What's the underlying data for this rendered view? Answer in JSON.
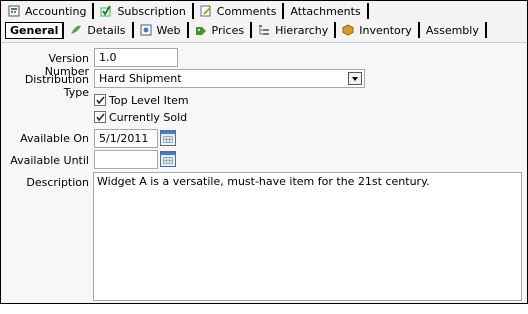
{
  "tabs_row1": [
    {
      "label": "Accounting",
      "icon": "accounting-icon"
    },
    {
      "label": "Subscription",
      "icon": "subscription-icon"
    },
    {
      "label": "Comments",
      "icon": "comments-icon"
    },
    {
      "label": "Attachments",
      "icon": ""
    }
  ],
  "tabs_row2": [
    {
      "label": "General",
      "icon": "",
      "active": true
    },
    {
      "label": "Details",
      "icon": "details-icon"
    },
    {
      "label": "Web",
      "icon": "web-icon"
    },
    {
      "label": "Prices",
      "icon": "prices-icon"
    },
    {
      "label": "Hierarchy",
      "icon": "hierarchy-icon"
    },
    {
      "label": "Inventory",
      "icon": "inventory-icon"
    },
    {
      "label": "Assembly",
      "icon": ""
    }
  ],
  "form": {
    "version_label": "Version Number",
    "version_value": "1.0",
    "distribution_label": "Distribution Type",
    "distribution_value": "Hard Shipment",
    "top_level_label": "Top Level Item",
    "top_level_checked": true,
    "currently_sold_label": "Currently Sold",
    "currently_sold_checked": true,
    "available_on_label": "Available On",
    "available_on_value": "5/1/2011",
    "available_until_label": "Available Until",
    "available_until_value": "",
    "description_label": "Description",
    "description_value": "Widget A is a versatile, must-have item for the 21st century."
  }
}
